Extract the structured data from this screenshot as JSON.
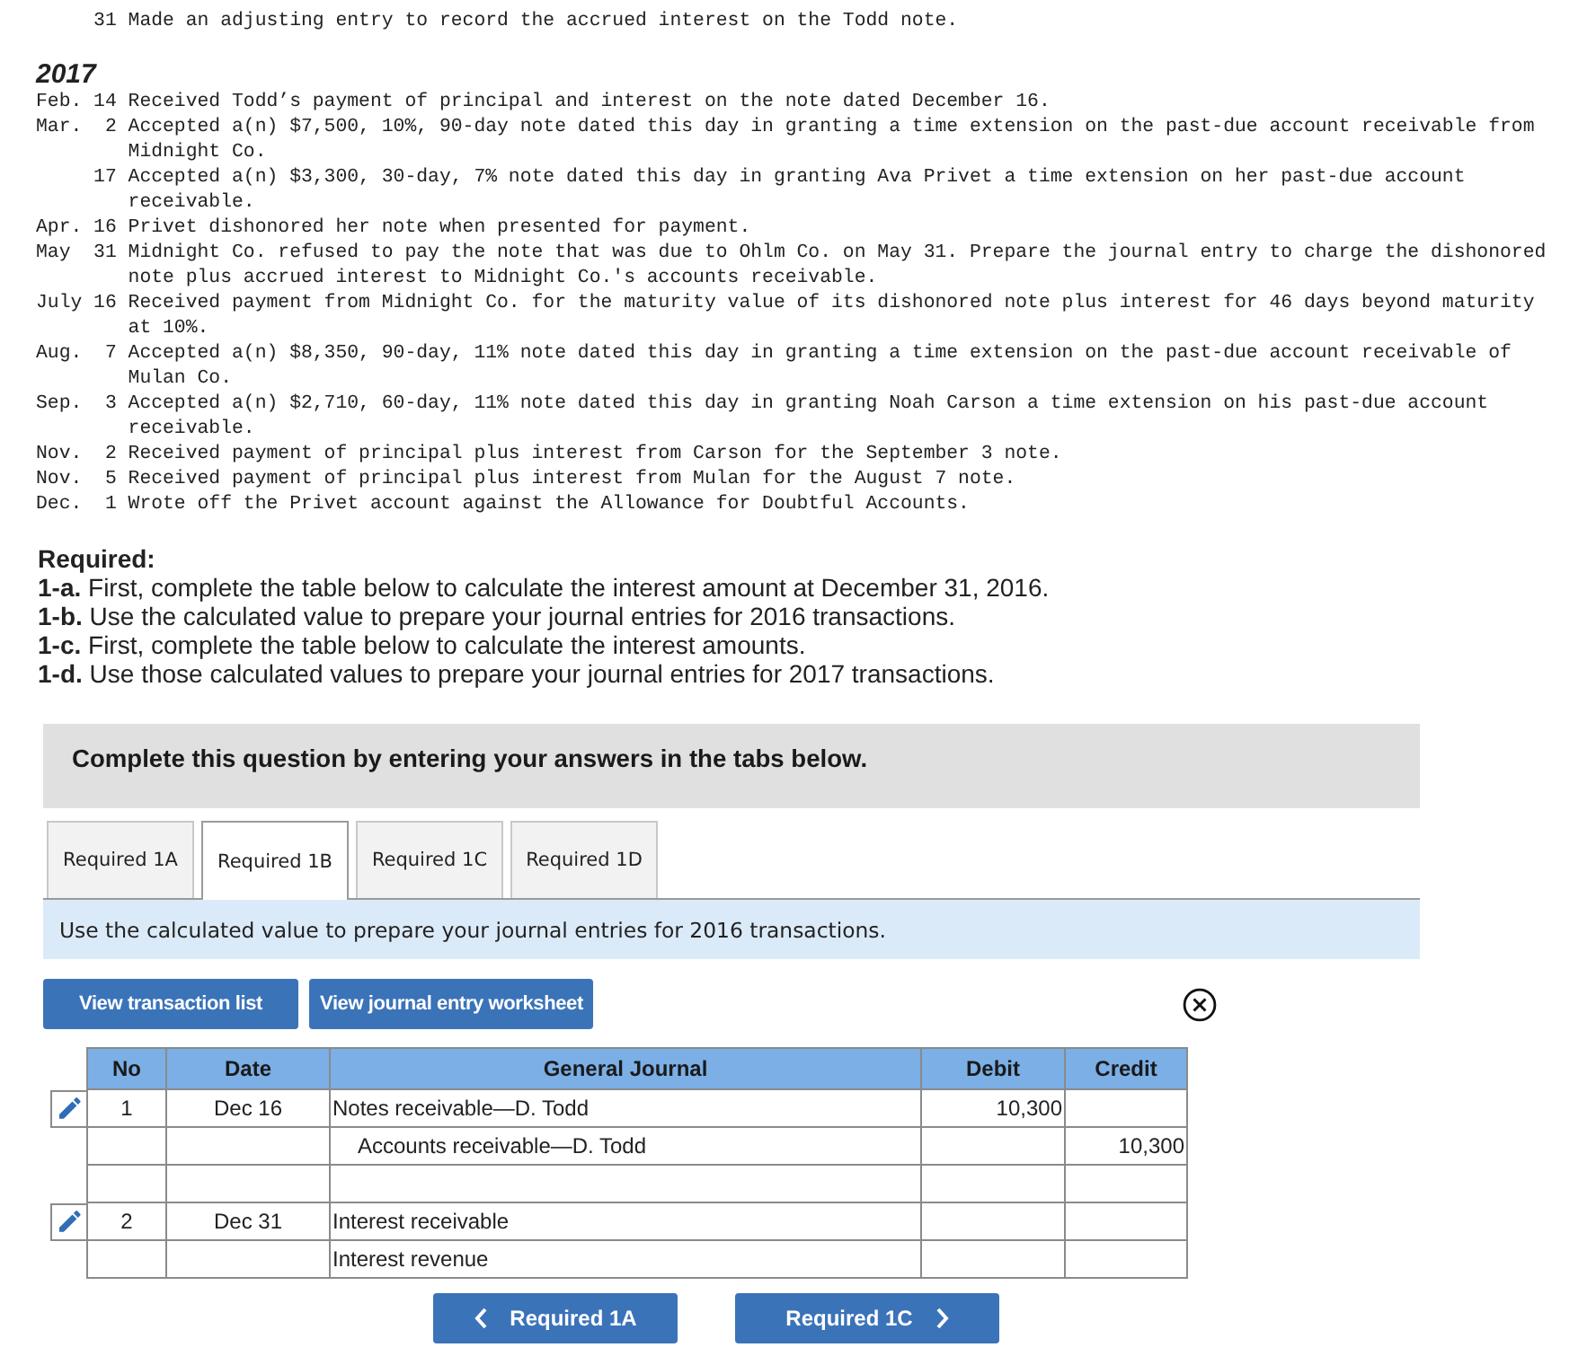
{
  "transactions_2016": [
    {
      "day": "31",
      "text": "Made an adjusting entry to record the accrued interest on the Todd note."
    }
  ],
  "year": "2017",
  "transactions_2017": [
    {
      "month": "Feb.",
      "day": "14",
      "text": "Received Todd’s payment of principal and interest on the note dated December 16."
    },
    {
      "month": "Mar.",
      "day": "2",
      "text": "Accepted a(n) $7,500, 10%, 90-day note dated this day in granting a time extension on the past-due account receivable from Midnight Co."
    },
    {
      "day": "17",
      "text": "Accepted a(n) $3,300, 30-day, 7% note dated this day in granting Ava Privet a time extension on her past-due account receivable."
    },
    {
      "month": "Apr.",
      "day": "16",
      "text": "Privet dishonored her note when presented for payment."
    },
    {
      "month": "May",
      "day": "31",
      "text": "Midnight Co. refused to pay the note that was due to Ohlm Co. on May 31. Prepare the journal entry to charge the dishonored note plus accrued interest to Midnight Co.'s accounts receivable."
    },
    {
      "month": "July",
      "day": "16",
      "text": "Received payment from Midnight Co. for the maturity value of its dishonored note plus interest for 46 days beyond maturity at 10%."
    },
    {
      "month": "Aug.",
      "day": "7",
      "text": "Accepted a(n) $8,350, 90-day, 11% note dated this day in granting a time extension on the past-due account receivable of Mulan Co."
    },
    {
      "month": "Sep.",
      "day": "3",
      "text": "Accepted a(n) $2,710, 60-day, 11% note dated this day in granting Noah Carson a time extension on his past-due account receivable."
    },
    {
      "month": "Nov.",
      "day": "2",
      "text": "Received payment of principal plus interest from Carson for the September 3 note."
    },
    {
      "month": "Nov.",
      "day": "5",
      "text": "Received payment of principal plus interest from Mulan for the August 7 note."
    },
    {
      "month": "Dec.",
      "day": "1",
      "text": "Wrote off the Privet account against the Allowance for Doubtful Accounts."
    }
  ],
  "required": {
    "heading": "Required:",
    "items": [
      "**1-a.** First, complete the table below to calculate the interest amount at December 31, 2016.",
      "**1-b.** Use the calculated value to prepare your journal entries for 2016 transactions.",
      "**1-c.** First, complete the table below to calculate the interest amounts.",
      "**1-d.** Use those calculated values to prepare your journal entries for 2017 transactions."
    ]
  },
  "prompt": "Complete this question by entering your answers in the tabs below.",
  "tabs": [
    {
      "label": "Required 1A",
      "selected": false
    },
    {
      "label": "Required 1B",
      "selected": true
    },
    {
      "label": "Required 1C",
      "selected": false
    },
    {
      "label": "Required 1D",
      "selected": false
    }
  ],
  "instruction": "Use the calculated value to prepare your journal entries for 2016 transactions.",
  "worksheet_buttons": [
    "View transaction list",
    "View journal entry worksheet"
  ],
  "journal": {
    "columns": [
      "No",
      "Date",
      "General Journal",
      "Debit",
      "Credit"
    ],
    "rows": [
      {
        "editable": true,
        "no": "1",
        "date": "Dec 16",
        "account": "Notes receivable—D. Todd",
        "indented": false,
        "debit": "10,300"
      },
      {
        "editable": false,
        "account": "Accounts receivable—D. Todd",
        "indented": true,
        "credit": "10,300"
      },
      {
        "editable": false
      },
      {
        "editable": true,
        "no": "2",
        "date": "Dec 31",
        "account": "Interest receivable",
        "indented": false
      },
      {
        "editable": false,
        "account": "Interest revenue",
        "indented": false
      }
    ]
  },
  "nav_buttons": [
    {
      "kind": "prev",
      "label": "Required 1A"
    },
    {
      "kind": "next",
      "label": "Required 1C"
    }
  ]
}
